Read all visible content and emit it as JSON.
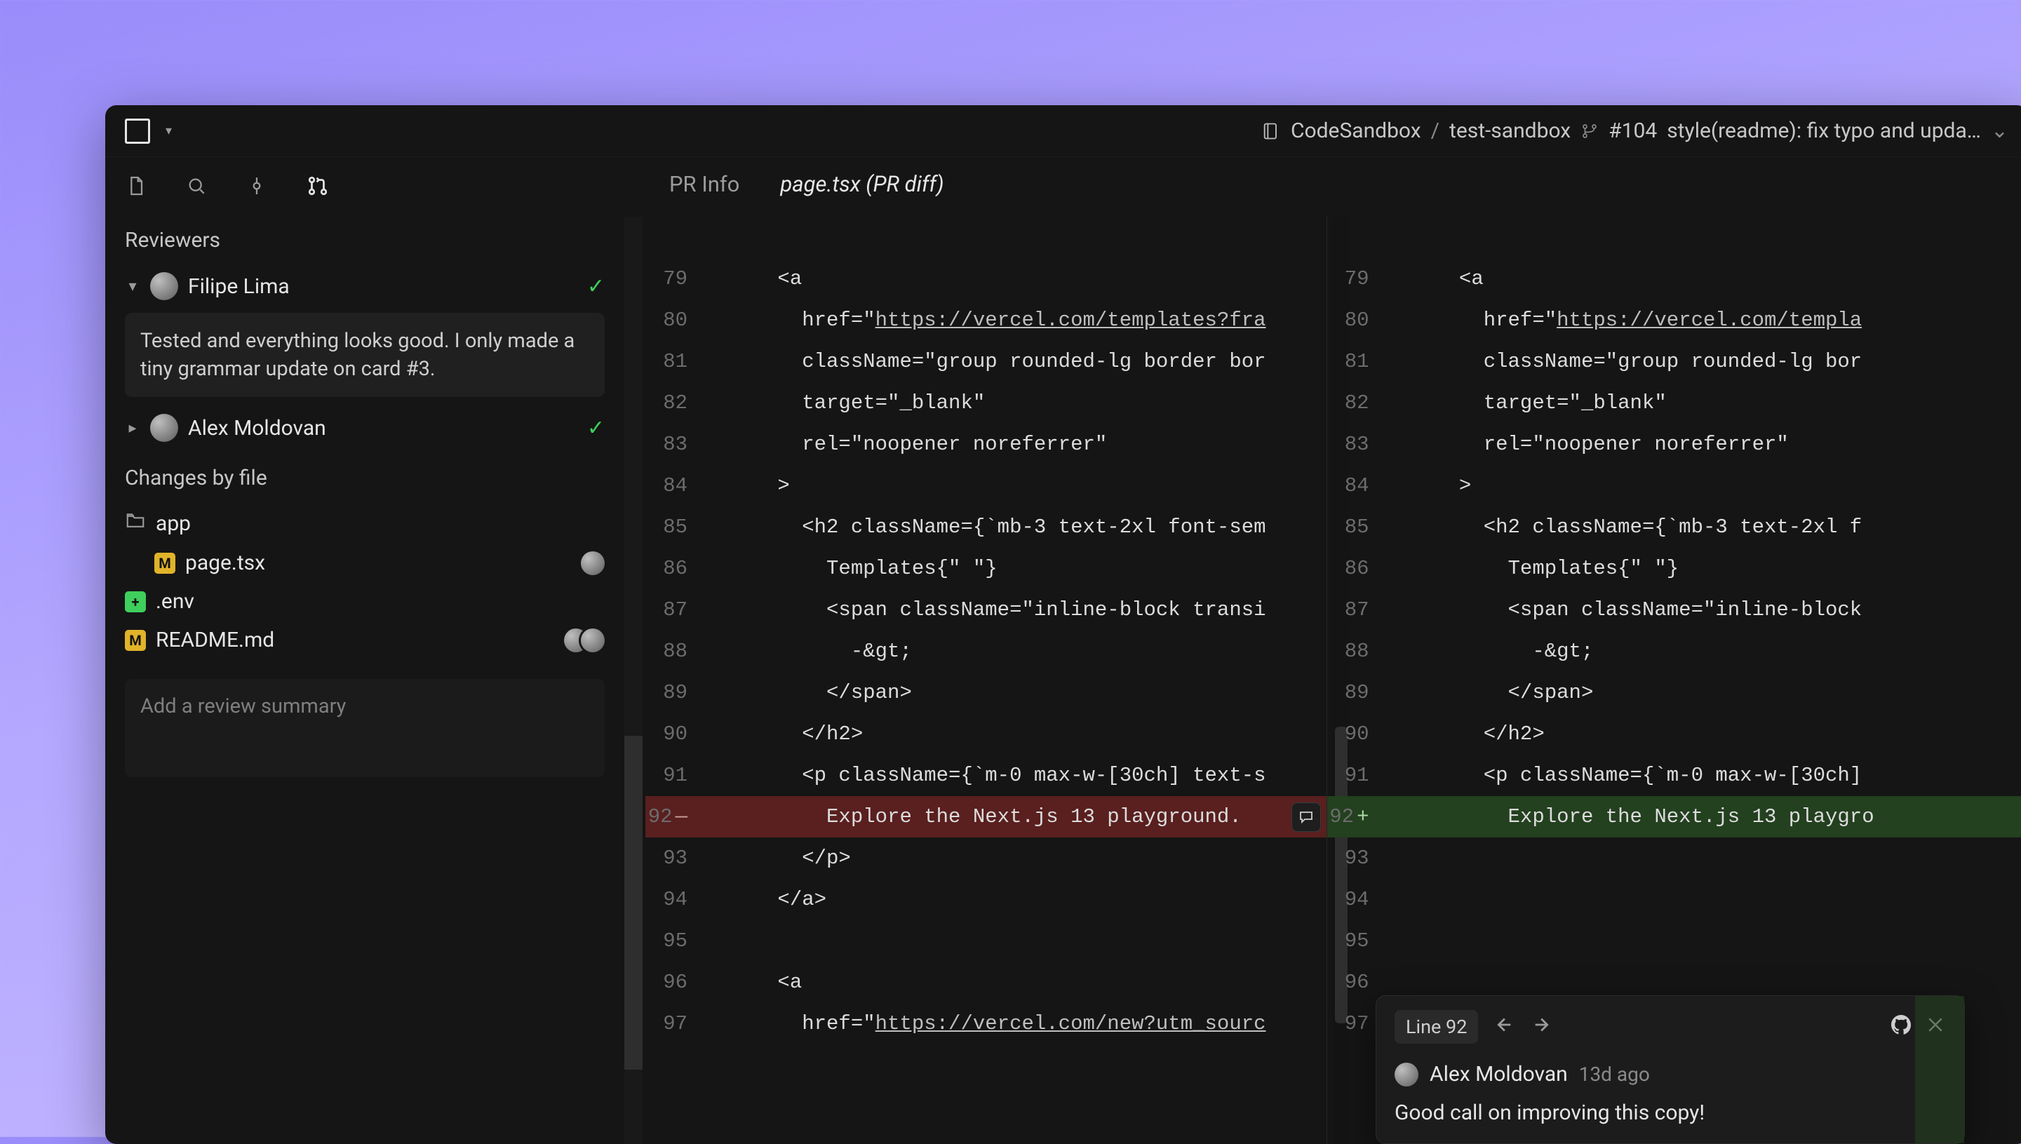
{
  "titlebar": {
    "org": "CodeSandbox",
    "repo": "test-sandbox",
    "pr_number": "#104",
    "pr_title": "style(readme): fix typo and upda…"
  },
  "sidebar": {
    "reviewers_label": "Reviewers",
    "reviewers": [
      {
        "name": "Filipe Lima",
        "expanded": true,
        "approved": true,
        "body": "Tested and everything looks good. I only made a tiny grammar update on card #3."
      },
      {
        "name": "Alex Moldovan",
        "expanded": false,
        "approved": true
      }
    ],
    "changes_label": "Changes by file",
    "files": {
      "folder": "app",
      "items": [
        {
          "name": "page.tsx",
          "status": "M",
          "avatars": 1
        },
        {
          "name": ".env",
          "status": "A",
          "avatars": 0
        },
        {
          "name": "README.md",
          "status": "M",
          "avatars": 2
        }
      ]
    },
    "review_summary_placeholder": "Add a review summary"
  },
  "content": {
    "tab_prinfo": "PR Info",
    "tab_active": "page.tsx (PR diff)"
  },
  "diff": {
    "left": [
      {
        "n": "",
        "code": ""
      },
      {
        "n": "79",
        "code": "      <a"
      },
      {
        "n": "80",
        "code": "        href=\"https://vercel.com/templates?fra",
        "url": true
      },
      {
        "n": "81",
        "code": "        className=\"group rounded-lg border bor"
      },
      {
        "n": "82",
        "code": "        target=\"_blank\""
      },
      {
        "n": "83",
        "code": "        rel=\"noopener noreferrer\""
      },
      {
        "n": "84",
        "code": "      >"
      },
      {
        "n": "85",
        "code": "        <h2 className={`mb-3 text-2xl font-sem"
      },
      {
        "n": "86",
        "code": "          Templates{\" \"}"
      },
      {
        "n": "87",
        "code": "          <span className=\"inline-block transi"
      },
      {
        "n": "88",
        "code": "            -&gt;"
      },
      {
        "n": "89",
        "code": "          </span>"
      },
      {
        "n": "90",
        "code": "        </h2>"
      },
      {
        "n": "91",
        "code": "        <p className={`m-0 max-w-[30ch] text-s"
      },
      {
        "n": "92",
        "code": "          Explore the Next.js 13 playground.",
        "removed": true,
        "comment_btn": true
      },
      {
        "n": "93",
        "code": "        </p>"
      },
      {
        "n": "94",
        "code": "      </a>"
      },
      {
        "n": "95",
        "code": ""
      },
      {
        "n": "96",
        "code": "      <a"
      },
      {
        "n": "97",
        "code": "        href=\"https://vercel.com/new?utm_sourc",
        "url": true
      }
    ],
    "right": [
      {
        "n": "",
        "code": ""
      },
      {
        "n": "79",
        "code": "      <a"
      },
      {
        "n": "80",
        "code": "        href=\"https://vercel.com/templa",
        "url": true
      },
      {
        "n": "81",
        "code": "        className=\"group rounded-lg bor"
      },
      {
        "n": "82",
        "code": "        target=\"_blank\""
      },
      {
        "n": "83",
        "code": "        rel=\"noopener noreferrer\""
      },
      {
        "n": "84",
        "code": "      >"
      },
      {
        "n": "85",
        "code": "        <h2 className={`mb-3 text-2xl f"
      },
      {
        "n": "86",
        "code": "          Templates{\" \"}"
      },
      {
        "n": "87",
        "code": "          <span className=\"inline-block "
      },
      {
        "n": "88",
        "code": "            -&gt;"
      },
      {
        "n": "89",
        "code": "          </span>"
      },
      {
        "n": "90",
        "code": "        </h2>"
      },
      {
        "n": "91",
        "code": "        <p className={`m-0 max-w-[30ch]"
      },
      {
        "n": "92",
        "code": "          Explore the Next.js 13 playgro",
        "added": true
      },
      {
        "n": "93",
        "code": ""
      },
      {
        "n": "94",
        "code": ""
      },
      {
        "n": "95",
        "code": ""
      },
      {
        "n": "96",
        "code": ""
      },
      {
        "n": "97",
        "code": ""
      }
    ]
  },
  "comment": {
    "line_chip": "Line 92",
    "author": "Alex Moldovan",
    "time": "13d ago",
    "body": "Good call on improving this copy!"
  }
}
